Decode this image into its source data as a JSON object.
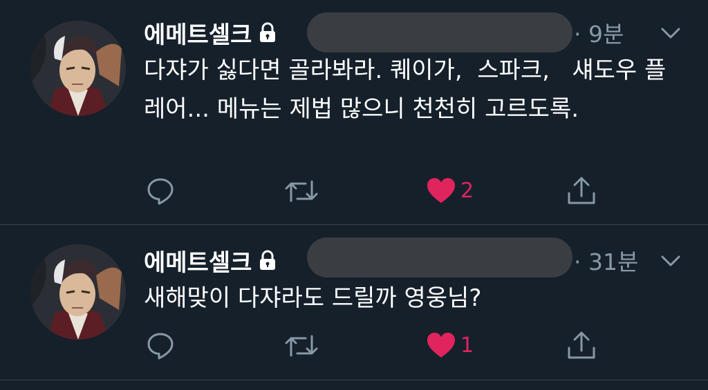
{
  "colors": {
    "background": "#15202b",
    "text": "#ffffff",
    "secondary": "#8899a6",
    "like": "#e0245e",
    "divider": "#38444d"
  },
  "tweets": [
    {
      "display_name": "에메트셀크",
      "protected_icon": "lock-icon",
      "handle_redacted": true,
      "time": "· 9분",
      "text": "다쟈가 싫다면 골라봐라. 퀘이가,  스파크,   섀도우 플레어... 메뉴는 제법 많으니 천천히 고르도록.",
      "like_count": "2",
      "icons": [
        "reply-icon",
        "retweet-icon",
        "heart-icon",
        "share-icon"
      ]
    },
    {
      "display_name": "에메트셀크",
      "protected_icon": "lock-icon",
      "handle_redacted": true,
      "time": "· 31분",
      "text": "새해맞이 다쟈라도 드릴까 영웅님?",
      "like_count": "1",
      "icons": [
        "reply-icon",
        "retweet-icon",
        "heart-icon",
        "share-icon"
      ]
    }
  ]
}
